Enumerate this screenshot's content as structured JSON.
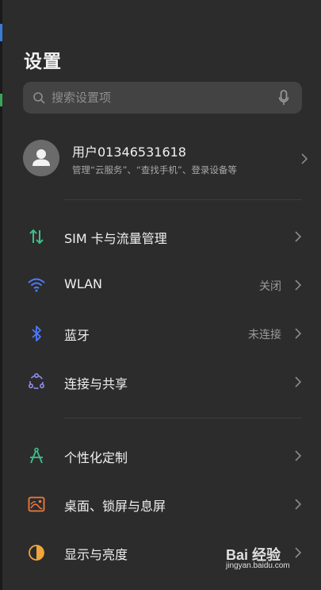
{
  "header": {
    "title": "设置"
  },
  "search": {
    "placeholder": "搜索设置项"
  },
  "account": {
    "name": "用户01346531618",
    "description": "管理“云服务”、“查找手机”、登录设备等"
  },
  "settings_items": [
    {
      "label": "SIM 卡与流量管理",
      "status": "",
      "icon": "sim-data-icon",
      "color": "#3fbf8a"
    },
    {
      "label": "WLAN",
      "status": "关闭",
      "icon": "wifi-icon",
      "color": "#4f7bff"
    },
    {
      "label": "蓝牙",
      "status": "未连接",
      "icon": "bluetooth-icon",
      "color": "#4f7bff"
    },
    {
      "label": "连接与共享",
      "status": "",
      "icon": "connection-share-icon",
      "color": "#8f8ff0"
    },
    {
      "label": "个性化定制",
      "status": "",
      "icon": "personalization-icon",
      "color": "#3fbf8a"
    },
    {
      "label": "桌面、锁屏与息屏",
      "status": "",
      "icon": "wallpaper-icon",
      "color": "#f07a3c"
    },
    {
      "label": "显示与亮度",
      "status": "",
      "icon": "display-brightness-icon",
      "color": "#f0a53c"
    }
  ],
  "watermark": {
    "logo": "Bai 经验",
    "url": "jingyan.baidu.com"
  }
}
